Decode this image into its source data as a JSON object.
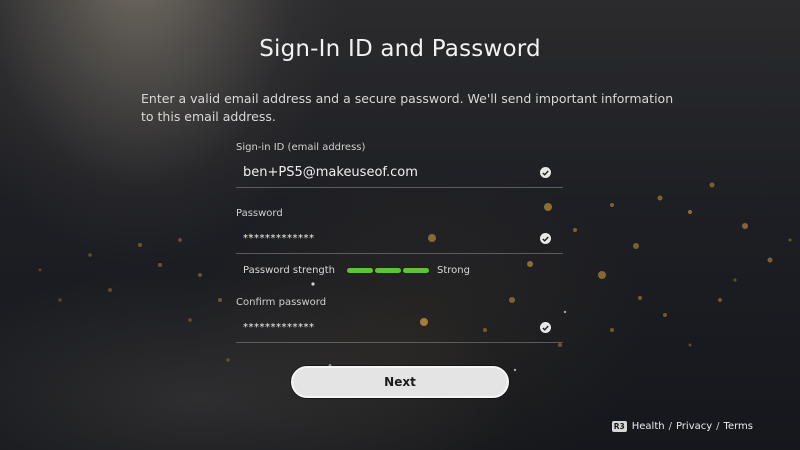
{
  "header": {
    "title": "Sign-In ID and Password",
    "description": "Enter a valid email address and a secure password. We'll send important information to this email address."
  },
  "form": {
    "signin_id": {
      "label": "Sign-in ID (email address)",
      "value": "ben+PS5@makeuseof.com",
      "status_icon": "check-icon"
    },
    "password": {
      "label": "Password",
      "value": "*************",
      "status_icon": "check-icon"
    },
    "strength": {
      "label": "Password strength",
      "level": 3,
      "max_level": 3,
      "value_label": "Strong",
      "color": "#5fc23c"
    },
    "confirm_password": {
      "label": "Confirm password",
      "value": "*************",
      "status_icon": "check-icon"
    }
  },
  "actions": {
    "next_label": "Next"
  },
  "footer": {
    "button_badge": "R3",
    "links": [
      "Health",
      "Privacy",
      "Terms"
    ],
    "separator": "/"
  }
}
